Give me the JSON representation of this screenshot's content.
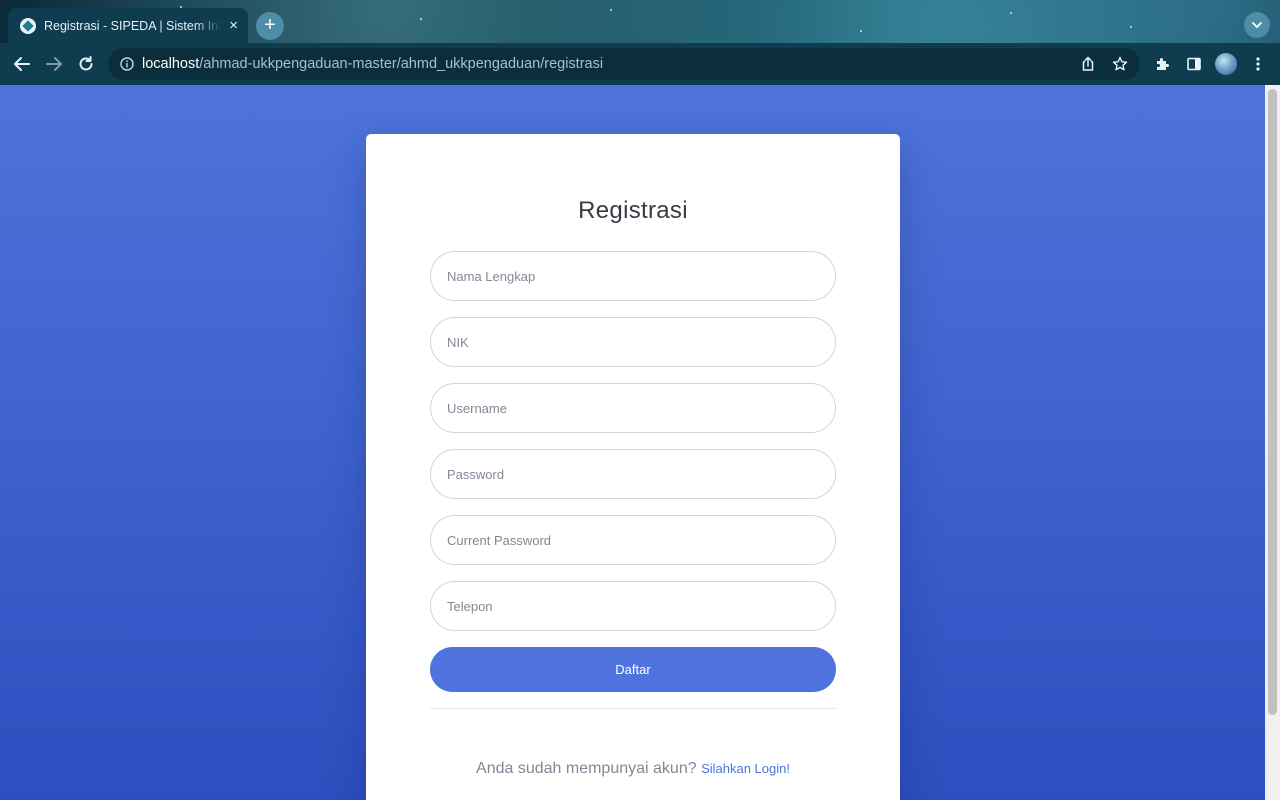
{
  "browser": {
    "tab_title": "Registrasi - SIPEDA | Sistem Informasi Pengaduan",
    "tab_close": "×",
    "new_tab": "+",
    "url_host": "localhost",
    "url_path": "/ahmad-ukkpengaduan-master/ahmd_ukkpengaduan/registrasi"
  },
  "form": {
    "title": "Registrasi",
    "fields": {
      "nama_lengkap": "Nama Lengkap",
      "nik": "NIK",
      "username": "Username",
      "password": "Password",
      "current_password": "Current Password",
      "telepon": "Telepon"
    },
    "submit_label": "Daftar",
    "login_prompt": "Anda sudah mempunyai akun?",
    "login_link": "Silahkan Login!"
  },
  "colors": {
    "primary": "#4e73df",
    "background_top": "#4e73d9",
    "background_bottom": "#2c4fbf"
  }
}
